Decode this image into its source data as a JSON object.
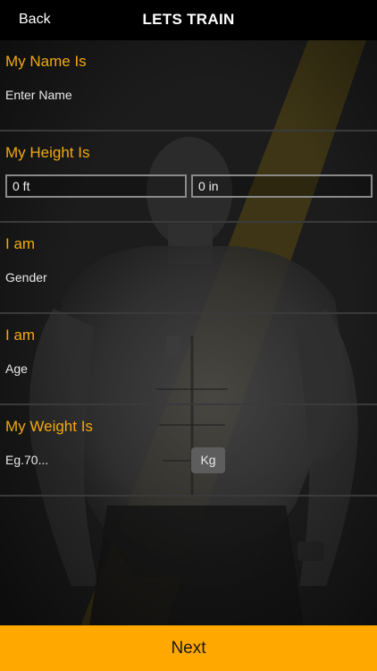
{
  "nav": {
    "back_label": "Back",
    "title": "LETS TRAIN"
  },
  "form": {
    "name": {
      "heading": "My Name Is",
      "placeholder": "Enter Name"
    },
    "height": {
      "heading": "My Height Is",
      "feet_value": "0 ft",
      "inches_value": "0 in"
    },
    "gender": {
      "heading": "I am",
      "placeholder": "Gender"
    },
    "age": {
      "heading": "I am",
      "placeholder": "Age"
    },
    "weight": {
      "heading": "My Weight Is",
      "placeholder": "Eg.70...",
      "unit_label": "Kg"
    }
  },
  "footer": {
    "next_label": "Next"
  },
  "colors": {
    "accent_orange": "#f2a90d",
    "next_button": "#ffa800",
    "navbar": "#000000"
  }
}
